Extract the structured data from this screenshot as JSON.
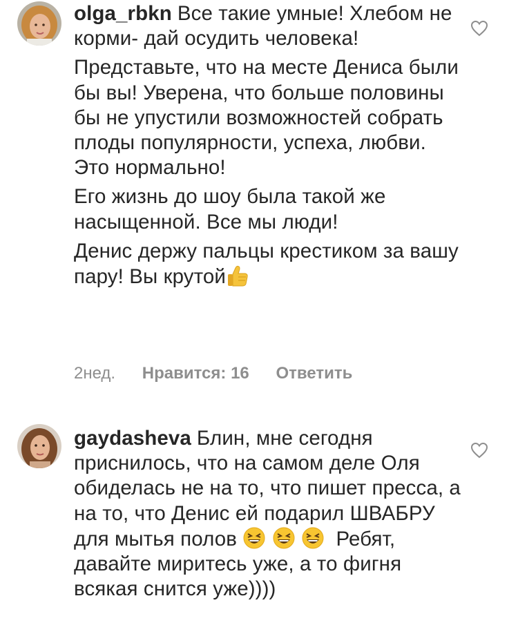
{
  "comments": [
    {
      "username": "olga_rbkn",
      "paragraphs": [
        "Все такие умные! Хлебом не корми- дай осудить человека!",
        "Представьте, что на месте Дениса были бы вы! Уверена, что больше половины бы не упустили возможностей собрать плоды популярности, успеха, любви. Это нормально!",
        "Его жизнь до шоу была такой же насыщенной. Все мы люди!",
        "Денис держу пальцы крестиком за вашу пару! Вы крутой"
      ],
      "trailing_emoji": "thumbs-up",
      "time": "2нед.",
      "likes": "Нравится: 16",
      "reply": "Ответить"
    },
    {
      "username": "gaydasheva",
      "text_before_emoji": "Блин, мне сегодня приснилось, что на самом деле Оля обиделась не на то, что пишет пресса, а на то, что Денис ей подарил ШВАБРУ для мытья полов",
      "emojis": [
        "grinning-squinting-face",
        "grinning-squinting-face",
        "grinning-squinting-face"
      ],
      "text_after_emoji": "Ребят, давайте миритесь уже, а то фигня всякая снится уже))))"
    }
  ],
  "colors": {
    "text": "#262626",
    "meta": "#8e8e8e",
    "heart_outline": "#8e8e8e"
  }
}
